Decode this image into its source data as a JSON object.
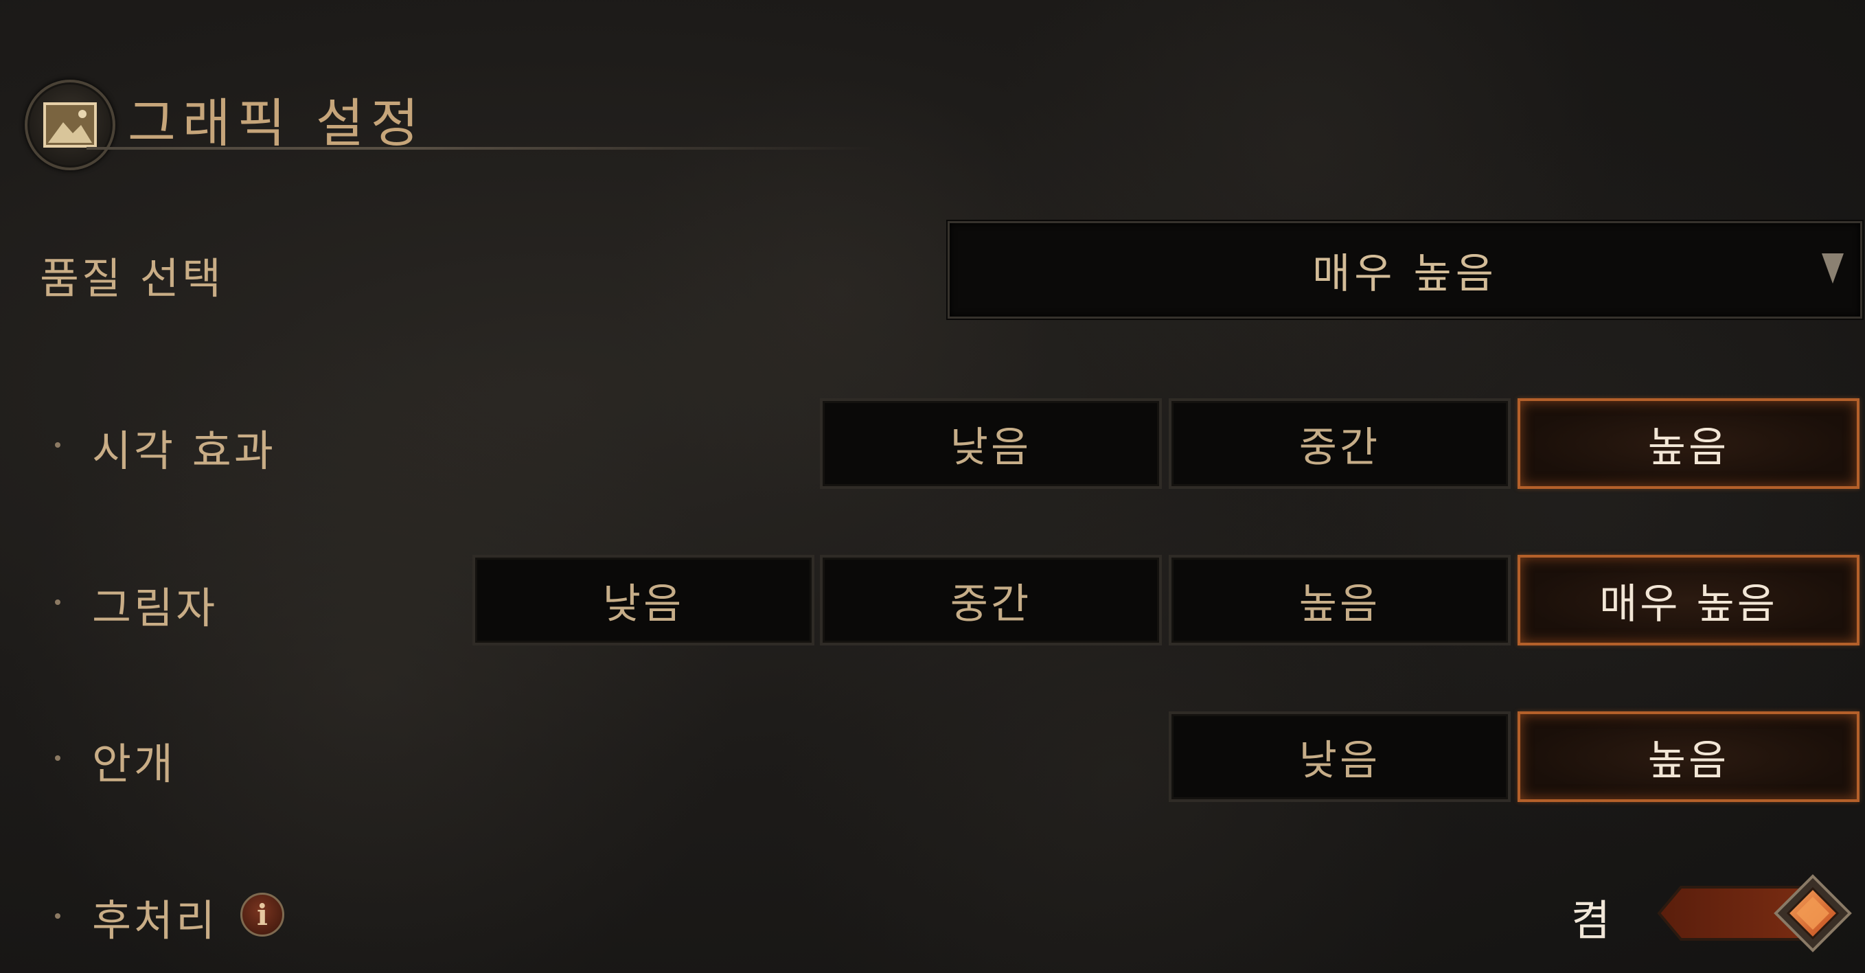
{
  "header": {
    "title": "그래픽 설정",
    "icon": "picture-frame-icon"
  },
  "quality": {
    "label": "품질 선택",
    "selected": "매우 높음",
    "arrow_icon": "chevron-down-icon"
  },
  "visual_effects": {
    "label": "시각 효과",
    "options": [
      "낮음",
      "중간",
      "높음"
    ],
    "selected": "높음"
  },
  "shadows": {
    "label": "그림자",
    "options": [
      "낮음",
      "중간",
      "높음",
      "매우 높음"
    ],
    "selected": "매우 높음"
  },
  "fog": {
    "label": "안개",
    "options": [
      "낮음",
      "높음"
    ],
    "selected": "높음"
  },
  "post_processing": {
    "label": "후처리",
    "info_icon": "info-icon",
    "info_glyph": "i",
    "state": "켬",
    "enabled": true
  },
  "colors": {
    "accent": "#b4602a",
    "label": "#c9ad86",
    "title": "#c6a57a"
  }
}
